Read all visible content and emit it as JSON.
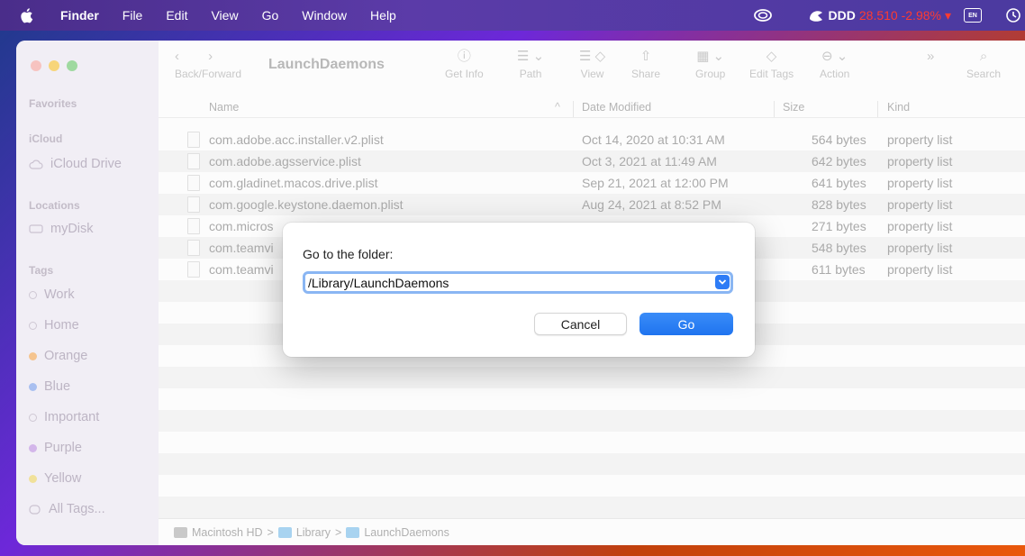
{
  "menubar": {
    "app": "Finder",
    "items": [
      "File",
      "Edit",
      "View",
      "Go",
      "Window",
      "Help"
    ],
    "ticker_symbol": "DDD",
    "ticker_price": "28.510 -2.98%",
    "ticker_arrow": "▾"
  },
  "window": {
    "title": "LaunchDaemons",
    "toolbar": {
      "back_forward": "Back/Forward",
      "get_info": "Get Info",
      "path": "Path",
      "view": "View",
      "share": "Share",
      "group": "Group",
      "edit_tags": "Edit Tags",
      "action": "Action",
      "search": "Search"
    }
  },
  "sidebar": {
    "favorites": "Favorites",
    "icloud": "iCloud",
    "icloud_drive": "iCloud Drive",
    "locations": "Locations",
    "mydisk": "myDisk",
    "tags": "Tags",
    "tag_items": [
      {
        "label": "Work",
        "color": "hollow"
      },
      {
        "label": "Home",
        "color": "hollow"
      },
      {
        "label": "Orange",
        "color": "#f5b26b"
      },
      {
        "label": "Blue",
        "color": "#9db5f0"
      },
      {
        "label": "Important",
        "color": "hollow"
      },
      {
        "label": "Purple",
        "color": "#c9a6e8"
      },
      {
        "label": "Yellow",
        "color": "#f2dc7a"
      }
    ],
    "all_tags": "All Tags..."
  },
  "columns": {
    "name": "Name",
    "date": "Date Modified",
    "size": "Size",
    "kind": "Kind"
  },
  "files": [
    {
      "name": "com.adobe.acc.installer.v2.plist",
      "date": "Oct 14, 2020 at 10:31 AM",
      "size": "564 bytes",
      "kind": "property list"
    },
    {
      "name": "com.adobe.agsservice.plist",
      "date": "Oct 3, 2021 at 11:49 AM",
      "size": "642 bytes",
      "kind": "property list"
    },
    {
      "name": "com.gladinet.macos.drive.plist",
      "date": "Sep 21, 2021 at 12:00 PM",
      "size": "641 bytes",
      "kind": "property list"
    },
    {
      "name": "com.google.keystone.daemon.plist",
      "date": "Aug 24, 2021 at 8:52 PM",
      "size": "828 bytes",
      "kind": "property list"
    },
    {
      "name": "com.micros",
      "date": "",
      "size": "271 bytes",
      "kind": "property list"
    },
    {
      "name": "com.teamvi",
      "date": "",
      "size": "548 bytes",
      "kind": "property list"
    },
    {
      "name": "com.teamvi",
      "date": "",
      "size": "611 bytes",
      "kind": "property list"
    }
  ],
  "pathbar": {
    "disk": "Macintosh HD",
    "library": "Library",
    "folder": "LaunchDaemons",
    "sep": ">"
  },
  "dialog": {
    "label": "Go to the folder:",
    "value": "/Library/LaunchDaemons",
    "cancel": "Cancel",
    "go": "Go"
  }
}
